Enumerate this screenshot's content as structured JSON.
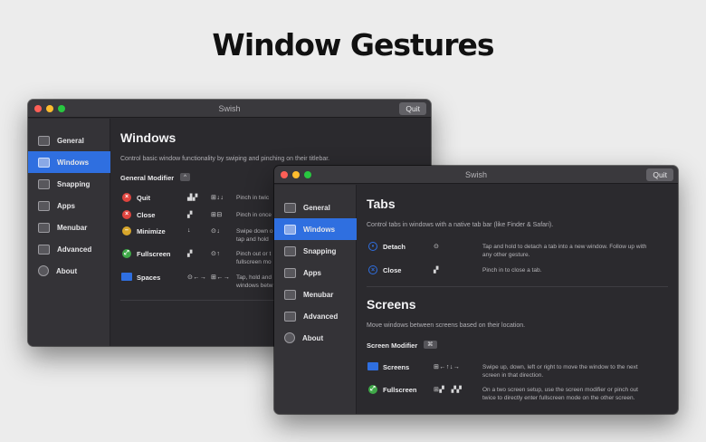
{
  "headline": "Window Gestures",
  "colors": {
    "accent": "#2f6fe0",
    "red": "#e0443e",
    "yellow": "#d7a62b",
    "green": "#3fa848",
    "blue": "#2f6fe0"
  },
  "window1": {
    "title": "Swish",
    "quit": "Quit",
    "sidebar": [
      {
        "label": "General",
        "icon": "general-icon"
      },
      {
        "label": "Windows",
        "icon": "windows-icon"
      },
      {
        "label": "Snapping",
        "icon": "snapping-icon"
      },
      {
        "label": "Apps",
        "icon": "apps-icon"
      },
      {
        "label": "Menubar",
        "icon": "menubar-icon"
      },
      {
        "label": "Advanced",
        "icon": "advanced-icon"
      },
      {
        "label": "About",
        "icon": "about-icon"
      }
    ],
    "heading": "Windows",
    "description": "Control basic window functionality by swiping and pinching on their titlebar.",
    "modifier_label": "General Modifier",
    "modifier_key": "^",
    "rows": [
      {
        "label": "Quit",
        "icon": "quit-icon",
        "g1": "▟▞",
        "g2": "⊞↓↓",
        "desc": "Pinch in twic"
      },
      {
        "label": "Close",
        "icon": "close-icon",
        "g1": "▞",
        "g2": "⊞⊟",
        "desc": "Pinch in once"
      },
      {
        "label": "Minimize",
        "icon": "minimize-icon",
        "g1": "↓",
        "g2": "⊙↓",
        "desc": "Swipe down o\ntap and hold"
      },
      {
        "label": "Fullscreen",
        "icon": "fullscreen-icon",
        "g1": "▞",
        "g2": "⊙↑",
        "desc": "Pinch out or t\nfullscreen mo"
      },
      {
        "label": "Spaces",
        "icon": "spaces-icon",
        "g1": "⊙←→",
        "g2": "⊞←→",
        "desc": "Tap, hold and\nwindows betw"
      }
    ]
  },
  "window2": {
    "title": "Swish",
    "quit": "Quit",
    "sidebar": [
      {
        "label": "General",
        "icon": "general-icon"
      },
      {
        "label": "Windows",
        "icon": "windows-icon"
      },
      {
        "label": "Snapping",
        "icon": "snapping-icon"
      },
      {
        "label": "Apps",
        "icon": "apps-icon"
      },
      {
        "label": "Menubar",
        "icon": "menubar-icon"
      },
      {
        "label": "Advanced",
        "icon": "advanced-icon"
      },
      {
        "label": "About",
        "icon": "about-icon"
      }
    ],
    "tabs_heading": "Tabs",
    "tabs_description": "Control tabs in windows with a native tab bar (like Finder & Safari).",
    "tab_rows": [
      {
        "label": "Detach",
        "icon": "detach-icon",
        "g1": "⊙",
        "desc": "Tap and hold to detach a tab into a new window. Follow up with\nany other gesture."
      },
      {
        "label": "Close",
        "icon": "close-tab-icon",
        "g1": "▞",
        "desc": "Pinch in to close a tab."
      }
    ],
    "screens_heading": "Screens",
    "screens_description": "Move windows between screens based on their location.",
    "modifier_label": "Screen Modifier",
    "modifier_key": "⌘",
    "screen_rows": [
      {
        "label": "Screens",
        "icon": "screens-icon",
        "g1": "⊞←↑↓→",
        "desc": "Swipe up, down, left or right to move the window to the next\nscreen in that direction."
      },
      {
        "label": "Fullscreen",
        "icon": "fullscreen-icon",
        "g1": "⊞▞   ▞▞",
        "desc": "On a two screen setup, use the screen modifier or pinch out\ntwice to directly enter fullscreen mode on the other screen."
      }
    ]
  }
}
